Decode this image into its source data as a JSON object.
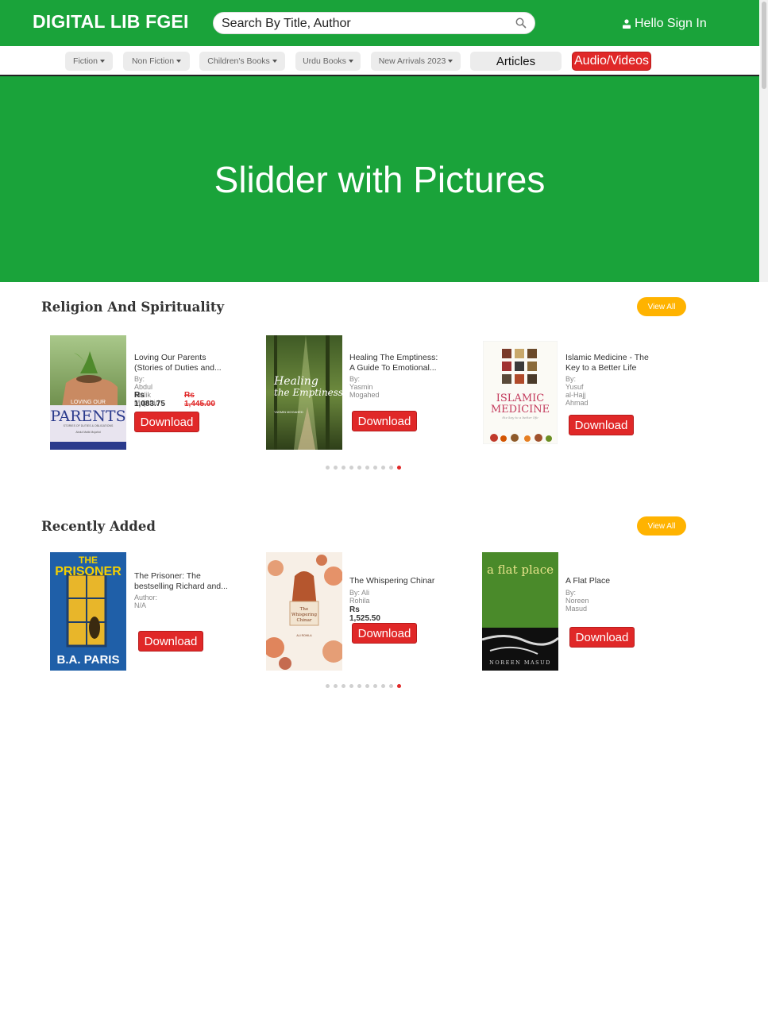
{
  "header": {
    "brand": "DIGITAL LIB FGEI",
    "search_value": "Search By Title, Author",
    "signin_label": "Hello Sign In"
  },
  "nav": {
    "items": [
      {
        "label": "Fiction"
      },
      {
        "label": "Non Fiction"
      },
      {
        "label": "Children's Books"
      },
      {
        "label": "Urdu Books"
      },
      {
        "label": "New Arrivals 2023"
      }
    ],
    "articles_label": "Articles",
    "audio_label": "Audio/Videos"
  },
  "hero": {
    "text": "Slidder with Pictures"
  },
  "colors": {
    "brand_green": "#1aa33a",
    "accent_red": "#e02828",
    "view_all_orange": "#ffb300"
  },
  "sections": [
    {
      "title": "Religion And Spirituality",
      "view_all": "View All",
      "books": [
        {
          "title_line1": "Loving Our Parents",
          "title_line2": "(Stories of Duties and...",
          "author": "By: Abdul Malik Mujahid",
          "price": "Rs 1,083.75",
          "old_price": "Rs 1,445.00",
          "button": "Download",
          "cover": {
            "top_text": "LOVING OUR",
            "main_text": "PARENTS",
            "sub_text": "STORIES OF DUTIES & OBLIGATIONS",
            "author_text": "Abdul Malik Mujahid"
          }
        },
        {
          "title_line1": "Healing The Emptiness:",
          "title_line2": "A Guide To Emotional...",
          "author": "By: Yasmin Mogahed",
          "button": "Download",
          "cover": {
            "line1": "Healing",
            "line2": "the Emptiness",
            "author_text": "YASMIN MOGAHED"
          }
        },
        {
          "title_line1": "Islamic Medicine - The",
          "title_line2": "Key to a Better Life",
          "author": "By: Yusuf al-Hajj Ahmad",
          "button": "Download",
          "cover": {
            "line1": "ISLAMIC",
            "line2": "MEDICINE",
            "tagline": "the key to a better life"
          }
        }
      ],
      "dots": {
        "count": 10,
        "active_index": 9
      }
    },
    {
      "title": "Recently Added",
      "view_all": "View All",
      "books": [
        {
          "title_line1": "The Prisoner: The",
          "title_line2": "bestselling Richard and...",
          "author": "Author: N/A",
          "button": "Download",
          "cover": {
            "line1": "THE",
            "line2": "PRISONER",
            "author_text": "B.A. PARIS"
          }
        },
        {
          "title_line1": "The Whispering Chinar",
          "author": "By: Ali Rohila",
          "price": "Rs 1,525.50",
          "button": "Download",
          "cover": {
            "line1": "The",
            "line2": "Whispering",
            "line3": "Chinar",
            "author_text": "ALI ROHILA"
          }
        },
        {
          "title_line1": "A Flat Place",
          "author": "By: Noreen Masud",
          "button": "Download",
          "cover": {
            "title_text": "a flat place",
            "author_text": "NOREEN MASUD"
          }
        }
      ],
      "dots": {
        "count": 10,
        "active_index": 9
      }
    }
  ]
}
